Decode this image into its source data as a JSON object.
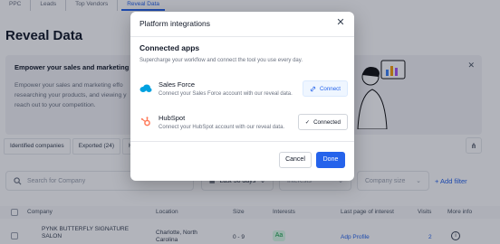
{
  "nav": {
    "tabs": [
      {
        "label": "PPC"
      },
      {
        "label": "Leads"
      },
      {
        "label": "Top Vendors"
      },
      {
        "label": "Reveal Data"
      }
    ],
    "active_tab": "Reveal Data"
  },
  "page": {
    "title": "Reveal Data"
  },
  "banner": {
    "title": "Empower your sales and marketing",
    "text": "Empower your sales and marketing effo researching your products, and viewing y reach out to your competition."
  },
  "subtabs": [
    {
      "label": "Identified companies"
    },
    {
      "label": "Exported (24)"
    },
    {
      "label": "Hid"
    }
  ],
  "filters": {
    "search_placeholder": "Search for Company",
    "date_range": "Last 30 days",
    "interests_placeholder": "Interests",
    "company_size_placeholder": "Company size",
    "add_filter_label": "+ Add filter"
  },
  "table": {
    "columns": [
      "Company",
      "Location",
      "Size",
      "Interests",
      "Last page of interest",
      "Visits",
      "More info"
    ],
    "rows": [
      {
        "company": "PYNK BUTTERFLY SIGNATURE SALON",
        "location": "Charlotte, North Carolina",
        "size": "0 - 9",
        "interests": "Aa",
        "last_page": "Adp Profile",
        "visits": "2",
        "more": "i"
      }
    ]
  },
  "modal": {
    "title": "Platform integrations",
    "section_title": "Connected apps",
    "section_desc": "Supercharge your workflow and connect the tool you use every day.",
    "apps": [
      {
        "name": "Sales Force",
        "description": "Connect your Sales Force account with our reveal data.",
        "button_label": "Connect",
        "status": "not-connected"
      },
      {
        "name": "HubSpot",
        "description": "Connect your HubSpot account with our reveal data.",
        "button_label": "Connected",
        "status": "connected"
      }
    ],
    "cancel_label": "Cancel",
    "done_label": "Done"
  },
  "colors": {
    "accent": "#2563eb",
    "overlay": "rgba(15,23,42,0.32)",
    "salesforce": "#00a1e0",
    "hubspot": "#ff7a59"
  },
  "icons": {
    "close": "close-icon",
    "link": "link-icon",
    "check": "check-icon",
    "search": "search-icon",
    "calendar": "calendar-icon",
    "share": "share-icon"
  }
}
